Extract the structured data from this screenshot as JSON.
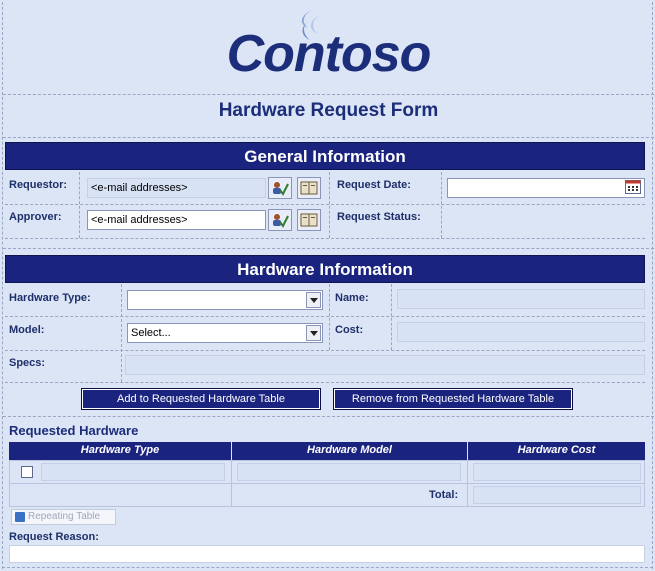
{
  "logo": {
    "text": "Contoso"
  },
  "form": {
    "title": "Hardware Request Form"
  },
  "general": {
    "heading": "General Information",
    "requestor_label": "Requestor:",
    "requestor_value": "<e-mail addresses>",
    "approver_label": "Approver:",
    "approver_value": "<e-mail addresses>",
    "request_date_label": "Request Date:",
    "request_date_value": "",
    "request_status_label": "Request Status:"
  },
  "hardware": {
    "heading": "Hardware Information",
    "type_label": "Hardware Type:",
    "type_value": "",
    "name_label": "Name:",
    "model_label": "Model:",
    "model_value": "Select...",
    "cost_label": "Cost:",
    "specs_label": "Specs:",
    "add_button": "Add to Requested Hardware Table",
    "remove_button": "Remove from Requested Hardware Table"
  },
  "requested": {
    "title": "Requested Hardware",
    "columns": [
      "Hardware Type",
      "Hardware Model",
      "Hardware Cost"
    ],
    "total_label": "Total:",
    "repeating_table_label": "Repeating Table"
  },
  "reason": {
    "label": "Request Reason:"
  },
  "icons": {
    "person": "address-book-check-icon",
    "book": "address-book-icon",
    "calendar": "calendar-icon",
    "dropdown": "chevron-down-icon"
  },
  "colors": {
    "accent": "#1a237e",
    "background": "#dbe5f5"
  }
}
